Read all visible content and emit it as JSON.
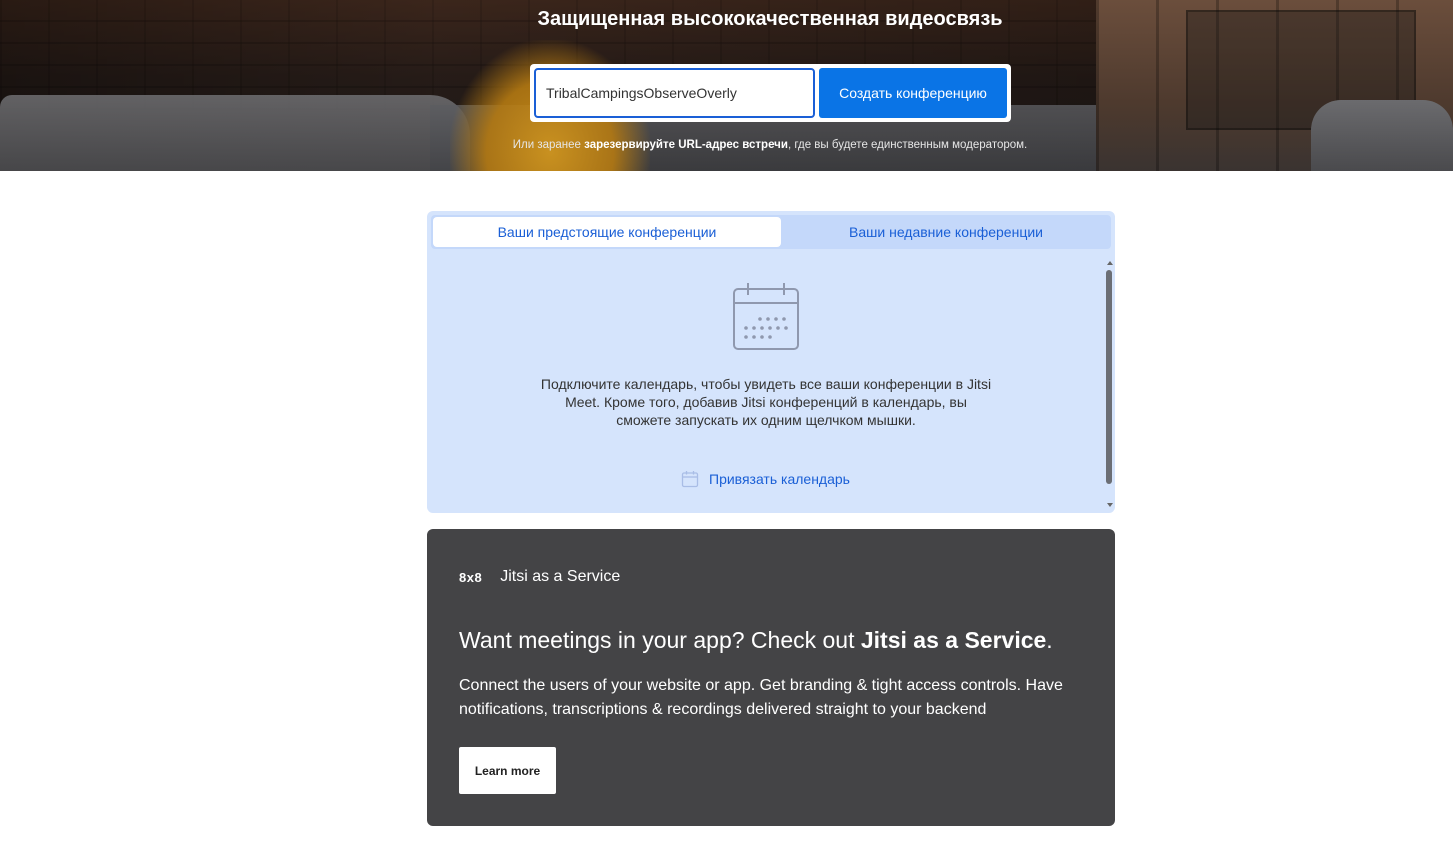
{
  "hero": {
    "title": "Защищенная высококачественная видеосвязь",
    "room_input_value": "TribalCampingsObserveOverly",
    "create_button_label": "Создать конференцию",
    "hint_prefix": "Или заранее ",
    "hint_link": "зарезервируйте URL-адрес встречи",
    "hint_suffix": ", где вы будете единственным модератором."
  },
  "calendar": {
    "tabs": [
      {
        "label": "Ваши предстоящие конференции",
        "active": true
      },
      {
        "label": "Ваши недавние конференции",
        "active": false
      }
    ],
    "empty_icon": "calendar-icon",
    "message": "Подключите календарь, чтобы увидеть все ваши конференции в Jitsi Meet. Кроме того, добавив Jitsi конференций в календарь, вы сможете запускать их одним щелчком мышки.",
    "link_icon": "calendar-small-icon",
    "link_label": "Привязать календарь"
  },
  "promo": {
    "logo_text": "8x8",
    "brand": "Jitsi as a Service",
    "title_prefix": "Want meetings in your app? Check out ",
    "title_bold": "Jitsi as a Service",
    "title_suffix": ".",
    "description": "Connect the users of your website or app. Get branding & tight access controls. Have notifications, transcriptions & recordings delivered straight to your backend",
    "button_label": "Learn more"
  },
  "colors": {
    "primary_blue": "#0a74e6",
    "link_blue": "#1a5fd6",
    "panel_bg": "#d5e4fc",
    "promo_bg": "#444446"
  }
}
